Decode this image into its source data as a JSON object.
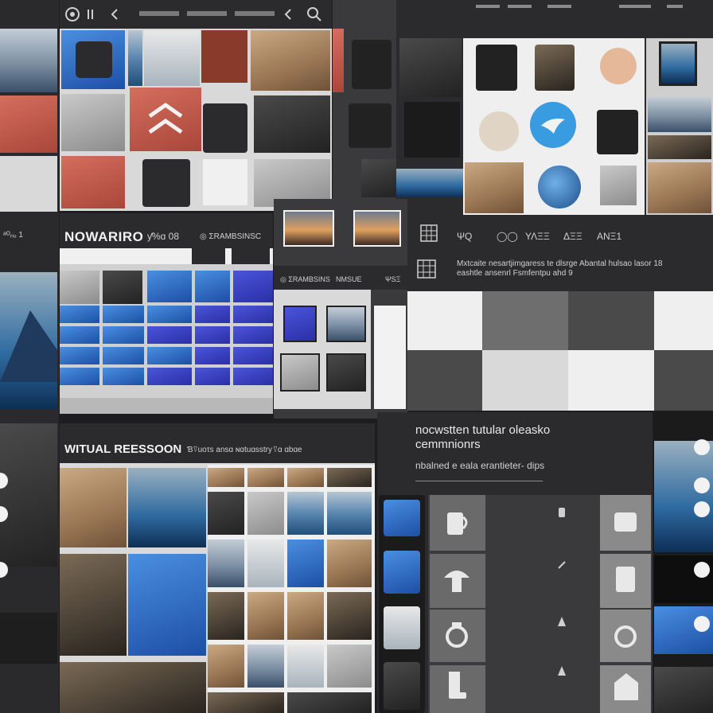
{
  "colors": {
    "dark": "#1d1d1f",
    "panel": "#2b2b2d",
    "accent_blue": "#2f6fd6",
    "accent_violet": "#3b3fc4",
    "light": "#f2f2f2"
  },
  "top_panel": {
    "title": "NOWARIRO",
    "subtitle": "ƴ%ɑ 08",
    "toolbar_text": "◎ ΣRAMBSINSC"
  },
  "middle_panel": {
    "toolbar_left": "◎ ΣRAMBSINS",
    "toolbar_right": "NMSUE",
    "tab_label": "ΨSΞ"
  },
  "right_header": {
    "labels": [
      "ΨQ",
      "◯◯",
      "ΥΛΞΞ",
      "ΔΞΞ",
      "ΑΝΞ1"
    ],
    "description_line1": "Mxtcaite nesartjimgaress te dlsrge Abantal hulsao lasor 18",
    "description_line2": "eashtle ansenrl Fsmfentpu ahd 9"
  },
  "virtual_panel": {
    "title": "WITUAL REESSOON",
    "subtitle": "Ɓ⍢uoτs ansɑ ɴɑtuɑsstry",
    "badge": "⍢ɑ ɑbɑe"
  },
  "dark_panel": {
    "title_line1": "nocwstten tutular oleasko",
    "title_line2": "cemmnionrs",
    "caption": "nbalned e eala erantieter- dips"
  },
  "left_header": {
    "text": "ᵃᴼᵣᵢᵤ 1"
  }
}
